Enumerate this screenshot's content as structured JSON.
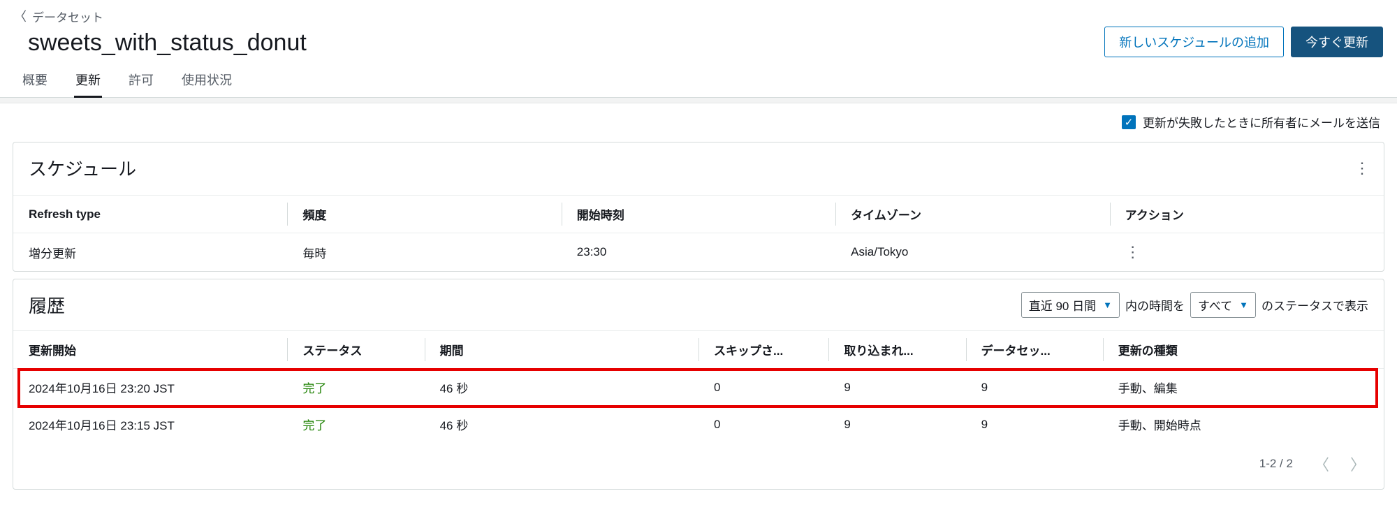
{
  "breadcrumb": {
    "label": "データセット"
  },
  "page_title": "sweets_with_status_donut",
  "buttons": {
    "add_schedule": "新しいスケジュールの追加",
    "refresh_now": "今すぐ更新"
  },
  "tabs": {
    "overview": "概要",
    "refresh": "更新",
    "permission": "許可",
    "usage": "使用状況"
  },
  "mail_checkbox_label": "更新が失敗したときに所有者にメールを送信",
  "schedule": {
    "title": "スケジュール",
    "headers": {
      "refresh_type": "Refresh type",
      "frequency": "頻度",
      "start_time": "開始時刻",
      "timezone": "タイムゾーン",
      "action": "アクション"
    },
    "row": {
      "refresh_type": "増分更新",
      "frequency": "毎時",
      "start_time": "23:30",
      "timezone": "Asia/Tokyo"
    }
  },
  "history": {
    "title": "履歴",
    "filter_range_label": "直近 90 日間",
    "filter_mid_text": "内の時間を",
    "filter_status_label": "すべて",
    "filter_suffix_text": "のステータスで表示",
    "headers": {
      "start": "更新開始",
      "status": "ステータス",
      "duration": "期間",
      "skipped": "スキップさ...",
      "ingested": "取り込まれ...",
      "dataset": "データセッ...",
      "type": "更新の種類"
    },
    "rows": [
      {
        "start": "2024年10月16日 23:20 JST",
        "status": "完了",
        "duration": "46 秒",
        "skipped": "0",
        "ingested": "9",
        "dataset": "9",
        "type": "手動、編集",
        "highlighted": true
      },
      {
        "start": "2024年10月16日 23:15 JST",
        "status": "完了",
        "duration": "46 秒",
        "skipped": "0",
        "ingested": "9",
        "dataset": "9",
        "type": "手動、開始時点",
        "highlighted": false
      }
    ],
    "pager": "1-2 / 2"
  }
}
